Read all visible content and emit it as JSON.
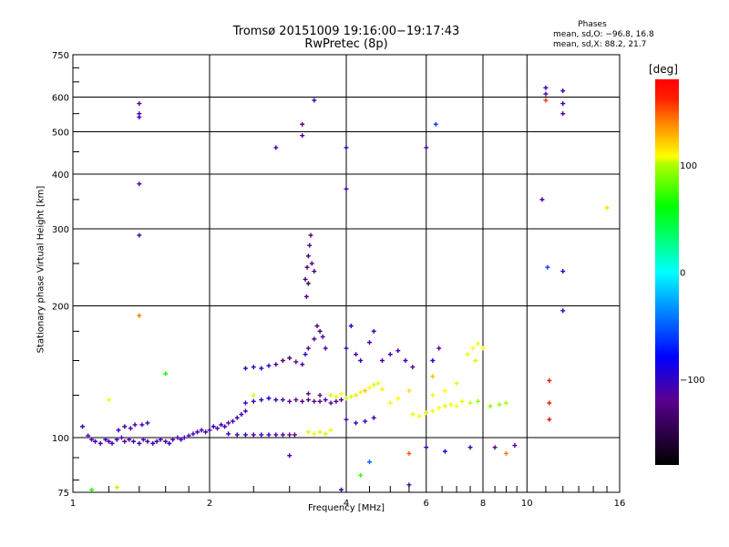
{
  "chart_data": {
    "type": "scatter",
    "title": "Tromsø 20151009 19:16:00−19:17:43",
    "subtitle": "RwPretec (8p)",
    "xlabel": "Frequency [MHz]",
    "ylabel": "Stationary phase Virtual Height [km]",
    "xscale": "log",
    "yscale": "log",
    "xlim": [
      1,
      16
    ],
    "ylim": [
      75,
      750
    ],
    "xticks": [
      1,
      2,
      4,
      6,
      8,
      10,
      16
    ],
    "xtick_labels": [
      "1",
      "2",
      "4",
      "6",
      "8",
      "10",
      "16"
    ],
    "yticks": [
      75,
      100,
      200,
      300,
      400,
      500,
      600,
      750
    ],
    "ytick_labels": [
      "75",
      "100",
      "200",
      "300",
      "400",
      "500",
      "600",
      "750"
    ],
    "grid": true,
    "legend": {
      "heading": "Phases",
      "o_mode": "mean, sd,O:  −96.8, 16.8",
      "x_mode": "mean, sd,X:  88.2, 21.7"
    },
    "colorbar": {
      "unit": "[deg]",
      "range": [
        -180,
        180
      ],
      "ticks": [
        100,
        0,
        -100
      ],
      "tick_labels": [
        "100",
        "0",
        "−100"
      ]
    },
    "point_fields": [
      "frequency_MHz",
      "virtual_height_km",
      "phase_deg"
    ],
    "points": [
      [
        1.08,
        101,
        -110
      ],
      [
        1.1,
        99,
        -115
      ],
      [
        1.12,
        98,
        -105
      ],
      [
        1.15,
        97,
        -110
      ],
      [
        1.18,
        99,
        -100
      ],
      [
        1.2,
        98,
        -115
      ],
      [
        1.22,
        97,
        -110
      ],
      [
        1.25,
        99,
        -105
      ],
      [
        1.28,
        100,
        -110
      ],
      [
        1.3,
        98,
        -120
      ],
      [
        1.33,
        99,
        -110
      ],
      [
        1.36,
        98,
        -105
      ],
      [
        1.4,
        97,
        -110
      ],
      [
        1.43,
        99,
        -115
      ],
      [
        1.46,
        98,
        -110
      ],
      [
        1.5,
        97,
        -100
      ],
      [
        1.53,
        98,
        -110
      ],
      [
        1.56,
        99,
        -115
      ],
      [
        1.6,
        98,
        -110
      ],
      [
        1.63,
        97,
        -105
      ],
      [
        1.66,
        99,
        -110
      ],
      [
        1.7,
        100,
        -112
      ],
      [
        1.73,
        99,
        -108
      ],
      [
        1.76,
        100,
        -110
      ],
      [
        1.8,
        101,
        -115
      ],
      [
        1.84,
        102,
        -110
      ],
      [
        1.88,
        103,
        -105
      ],
      [
        1.92,
        104,
        -110
      ],
      [
        1.96,
        103,
        -110
      ],
      [
        1.05,
        106,
        -105
      ],
      [
        1.26,
        104,
        -100
      ],
      [
        1.3,
        106,
        -110
      ],
      [
        1.34,
        105,
        -112
      ],
      [
        1.37,
        107,
        -108
      ],
      [
        1.42,
        107,
        -110
      ],
      [
        1.46,
        108,
        -105
      ],
      [
        2.0,
        104,
        -110
      ],
      [
        2.04,
        106,
        -100
      ],
      [
        2.08,
        105,
        -110
      ],
      [
        2.12,
        107,
        -105
      ],
      [
        2.16,
        106,
        -110
      ],
      [
        2.2,
        108,
        -115
      ],
      [
        2.25,
        109,
        -100
      ],
      [
        2.3,
        111,
        -110
      ],
      [
        2.35,
        113,
        -105
      ],
      [
        2.4,
        115,
        -110
      ],
      [
        2.2,
        102,
        -100
      ],
      [
        2.3,
        101.5,
        -105
      ],
      [
        2.4,
        101.5,
        -100
      ],
      [
        2.5,
        101.5,
        -110
      ],
      [
        2.6,
        101.5,
        -105
      ],
      [
        2.7,
        101.5,
        -100
      ],
      [
        2.8,
        101.5,
        -110
      ],
      [
        2.9,
        101.5,
        -115
      ],
      [
        3.0,
        101.5,
        -120
      ],
      [
        3.08,
        101.5,
        -125
      ],
      [
        2.4,
        120,
        -100
      ],
      [
        2.5,
        121,
        -105
      ],
      [
        2.6,
        122,
        -100
      ],
      [
        2.7,
        123,
        -95
      ],
      [
        2.8,
        122,
        -100
      ],
      [
        2.9,
        122,
        -110
      ],
      [
        3.0,
        121,
        -120
      ],
      [
        3.1,
        122,
        -125
      ],
      [
        3.2,
        121,
        -120
      ],
      [
        3.3,
        122,
        -130
      ],
      [
        3.4,
        121,
        -115
      ],
      [
        3.5,
        121,
        -120
      ],
      [
        3.6,
        122,
        -110
      ],
      [
        3.7,
        120,
        -115
      ],
      [
        3.8,
        121,
        -125
      ],
      [
        3.9,
        122,
        -110
      ],
      [
        3.5,
        125,
        -120
      ],
      [
        3.3,
        126,
        -125
      ],
      [
        2.4,
        144,
        -100
      ],
      [
        2.5,
        145,
        -105
      ],
      [
        2.6,
        144,
        -95
      ],
      [
        2.7,
        146,
        -100
      ],
      [
        2.8,
        147,
        -110
      ],
      [
        2.9,
        150,
        -125
      ],
      [
        3.0,
        152,
        -130
      ],
      [
        3.1,
        149,
        -120
      ],
      [
        3.2,
        147,
        -110
      ],
      [
        3.25,
        155,
        -105
      ],
      [
        3.3,
        160,
        -130
      ],
      [
        3.4,
        168,
        -125
      ],
      [
        3.5,
        175,
        -130
      ],
      [
        3.45,
        180,
        -120
      ],
      [
        3.55,
        170,
        -115
      ],
      [
        3.6,
        160,
        -110
      ],
      [
        3.25,
        230,
        -130
      ],
      [
        3.28,
        245,
        -130
      ],
      [
        3.3,
        260,
        -135
      ],
      [
        3.32,
        275,
        -125
      ],
      [
        3.34,
        290,
        -130
      ],
      [
        3.36,
        250,
        -120
      ],
      [
        3.3,
        225,
        -140
      ],
      [
        3.4,
        240,
        -130
      ],
      [
        3.27,
        210,
        -120
      ],
      [
        3.7,
        125,
        90
      ],
      [
        3.8,
        124,
        95
      ],
      [
        3.9,
        126,
        100
      ],
      [
        4.0,
        123,
        85
      ],
      [
        4.1,
        124,
        90
      ],
      [
        4.2,
        125,
        110
      ],
      [
        4.3,
        127,
        95
      ],
      [
        4.4,
        128,
        120
      ],
      [
        4.5,
        130,
        100
      ],
      [
        4.6,
        132,
        90
      ],
      [
        4.7,
        133,
        95
      ],
      [
        4.8,
        129,
        105
      ],
      [
        3.3,
        103,
        90
      ],
      [
        3.4,
        102,
        95
      ],
      [
        3.5,
        103,
        90
      ],
      [
        3.6,
        102,
        85
      ],
      [
        3.7,
        104,
        95
      ],
      [
        5.6,
        113,
        95
      ],
      [
        5.8,
        112,
        100
      ],
      [
        6.0,
        114,
        110
      ],
      [
        6.2,
        115,
        95
      ],
      [
        6.4,
        117,
        100
      ],
      [
        6.6,
        118,
        90
      ],
      [
        6.8,
        119,
        95
      ],
      [
        7.0,
        118,
        100
      ],
      [
        7.2,
        121,
        95
      ],
      [
        7.5,
        120,
        85
      ],
      [
        7.8,
        121,
        70
      ],
      [
        8.3,
        118,
        65
      ],
      [
        8.7,
        119,
        70
      ],
      [
        9.0,
        120,
        75
      ],
      [
        5.0,
        120,
        95
      ],
      [
        5.2,
        123,
        100
      ],
      [
        5.5,
        128,
        110
      ],
      [
        6.2,
        125,
        95
      ],
      [
        6.6,
        128,
        100
      ],
      [
        7.0,
        133,
        90
      ],
      [
        6.2,
        138,
        120
      ],
      [
        7.4,
        155,
        95
      ],
      [
        7.6,
        160,
        100
      ],
      [
        7.8,
        164,
        95
      ],
      [
        8.0,
        160,
        100
      ],
      [
        7.7,
        150,
        90
      ],
      [
        4.0,
        160,
        -105
      ],
      [
        4.2,
        155,
        -110
      ],
      [
        4.5,
        165,
        -115
      ],
      [
        4.8,
        150,
        -110
      ],
      [
        5.0,
        155,
        -105
      ],
      [
        5.2,
        158,
        -110
      ],
      [
        5.4,
        150,
        -110
      ],
      [
        5.6,
        145,
        -115
      ],
      [
        6.2,
        150,
        -95
      ],
      [
        6.4,
        160,
        -110
      ],
      [
        4.3,
        150,
        -105
      ],
      [
        4.6,
        175,
        -110
      ],
      [
        4.1,
        180,
        -95
      ],
      [
        4.0,
        110,
        -110
      ],
      [
        4.2,
        108,
        -105
      ],
      [
        4.4,
        109,
        -100
      ],
      [
        4.6,
        111,
        -110
      ],
      [
        1.4,
        580,
        -115
      ],
      [
        1.4,
        550,
        -110
      ],
      [
        1.4,
        540,
        -105
      ],
      [
        1.4,
        380,
        -110
      ],
      [
        1.4,
        290,
        -110
      ],
      [
        1.4,
        190,
        140
      ],
      [
        2.8,
        460,
        -110
      ],
      [
        3.2,
        520,
        -120
      ],
      [
        3.2,
        490,
        -115
      ],
      [
        3.4,
        590,
        -110
      ],
      [
        4.0,
        460,
        -100
      ],
      [
        4.0,
        370,
        -110
      ],
      [
        6.0,
        460,
        -110
      ],
      [
        6.3,
        520,
        -60
      ],
      [
        11.0,
        630,
        -100
      ],
      [
        11.0,
        610,
        -110
      ],
      [
        11.0,
        590,
        160
      ],
      [
        12.0,
        620,
        -110
      ],
      [
        12.0,
        580,
        -105
      ],
      [
        12.0,
        550,
        -115
      ],
      [
        10.8,
        350,
        -110
      ],
      [
        11.1,
        245,
        -60
      ],
      [
        12.0,
        240,
        -100
      ],
      [
        12.0,
        195,
        -105
      ],
      [
        11.2,
        135,
        170
      ],
      [
        11.2,
        120,
        170
      ],
      [
        11.2,
        110,
        175
      ],
      [
        15.0,
        335,
        110
      ],
      [
        1.6,
        140,
        20
      ],
      [
        1.2,
        122,
        100
      ],
      [
        2.5,
        125,
        90
      ],
      [
        3.0,
        91,
        -110
      ],
      [
        4.5,
        88,
        -50
      ],
      [
        5.5,
        92,
        150
      ],
      [
        6.0,
        95,
        -110
      ],
      [
        6.6,
        93,
        -80
      ],
      [
        7.5,
        95,
        -110
      ],
      [
        8.5,
        95,
        -120
      ],
      [
        9.0,
        92,
        140
      ],
      [
        9.4,
        96,
        -110
      ],
      [
        4.3,
        82,
        40
      ],
      [
        5.5,
        78,
        -110
      ],
      [
        3.9,
        76,
        -110
      ],
      [
        1.1,
        76,
        30
      ],
      [
        1.25,
        77,
        80
      ]
    ]
  }
}
